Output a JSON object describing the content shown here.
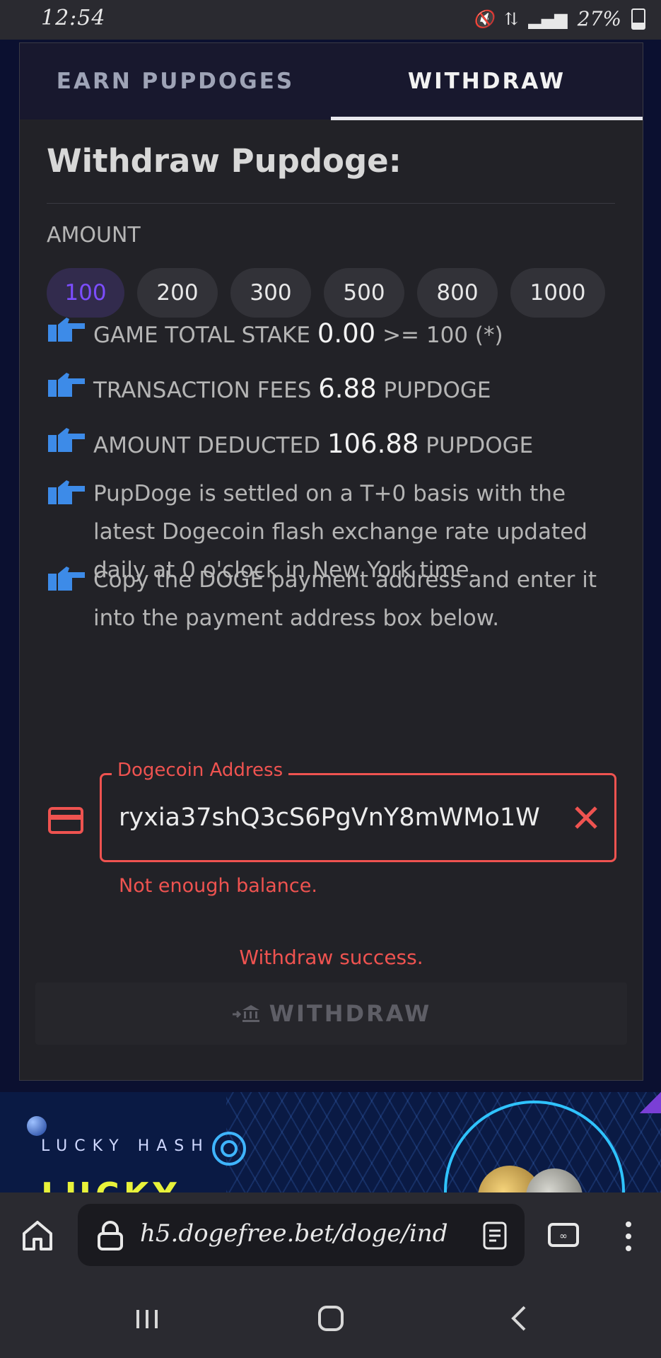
{
  "status_bar": {
    "time": "12:54",
    "battery": "27%",
    "battery_level": 0.27
  },
  "tabs": {
    "earn": "EARN PUPDOGES",
    "withdraw": "WITHDRAW",
    "active": "withdraw"
  },
  "form": {
    "title": "Withdraw Pupdoge:",
    "amount_label": "AMOUNT",
    "amounts": [
      "100",
      "200",
      "300",
      "500",
      "800",
      "1000"
    ],
    "selected_amount": "100",
    "info": {
      "stake_label": "GAME TOTAL STAKE",
      "stake_value": "0.00",
      "stake_suffix": ">= 100 (*)",
      "fees_label": "TRANSACTION FEES",
      "fees_value": "6.88",
      "fees_unit": "PUPDOGE",
      "deducted_label": "AMOUNT DEDUCTED",
      "deducted_value": "106.88",
      "deducted_unit": "PUPDOGE",
      "settle_line1": "PupDoge is settled on a T+0 basis with the",
      "settle_line2": "latest Dogecoin flash exchange rate updated",
      "settle_line3": "daily at 0 o'clock in New York time.",
      "copy_line1": "Copy the DOGE payment address and enter it",
      "copy_line2": "into the payment address box below."
    },
    "address_label": "Dogecoin Address",
    "address_value": "ryxia37shQ3cS6PgVnY8mWMo1W",
    "error_text": "Not enough balance.",
    "success_text": "Withdraw success.",
    "withdraw_button": "WITHDRAW"
  },
  "banner": {
    "brand": "LUCKY HASH",
    "headline": "LUCKY HASH"
  },
  "browser": {
    "url": "h5.dogefree.bet/doge/ind"
  },
  "colors": {
    "accent_purple": "#7c4dff",
    "error_red": "#ef5350",
    "thumb_blue": "#3d8be8",
    "card_bg": "#222227"
  },
  "icons": [
    "thumbs-up-point-icon",
    "credit-card-icon",
    "close-icon",
    "bank-transfer-icon",
    "home-icon",
    "lock-icon",
    "reader-mode-icon",
    "tabs-icon",
    "more-menu-icon",
    "recent-apps-icon",
    "nav-home-icon",
    "back-icon"
  ]
}
